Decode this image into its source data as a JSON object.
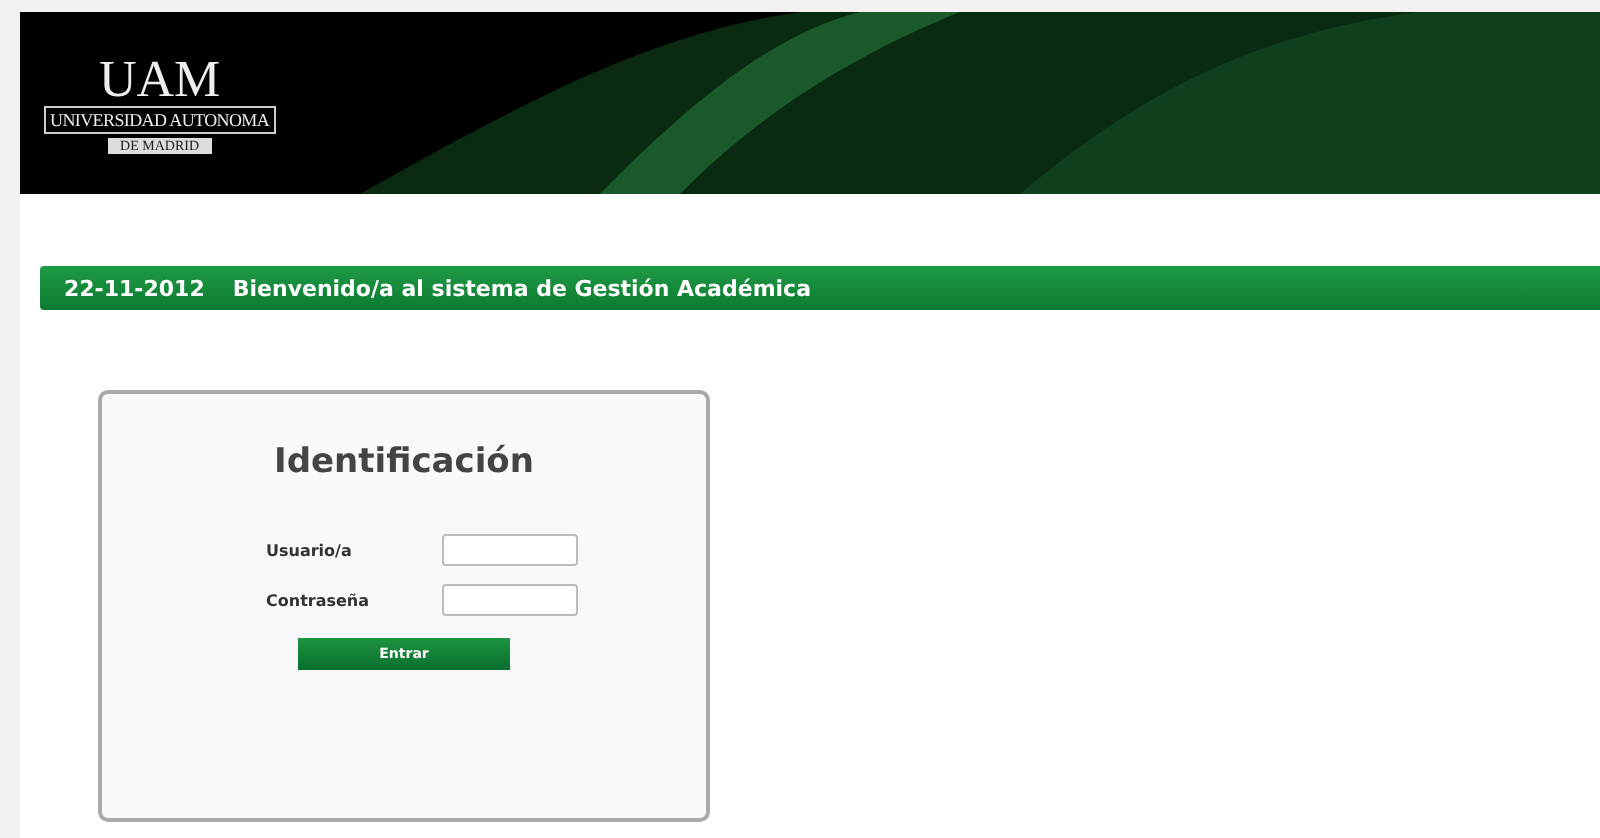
{
  "header": {
    "logo": {
      "mark": "UAM",
      "name": "UNIVERSIDAD AUTONOMA",
      "city": "DE MADRID"
    }
  },
  "welcome_bar": {
    "date": "22-11-2012",
    "message": "Bienvenido/a al sistema de Gestión Académica"
  },
  "login": {
    "title": "Identificación",
    "fields": [
      {
        "label": "Usuario/a"
      },
      {
        "label": "Contraseña"
      }
    ],
    "button": "Entrar"
  }
}
